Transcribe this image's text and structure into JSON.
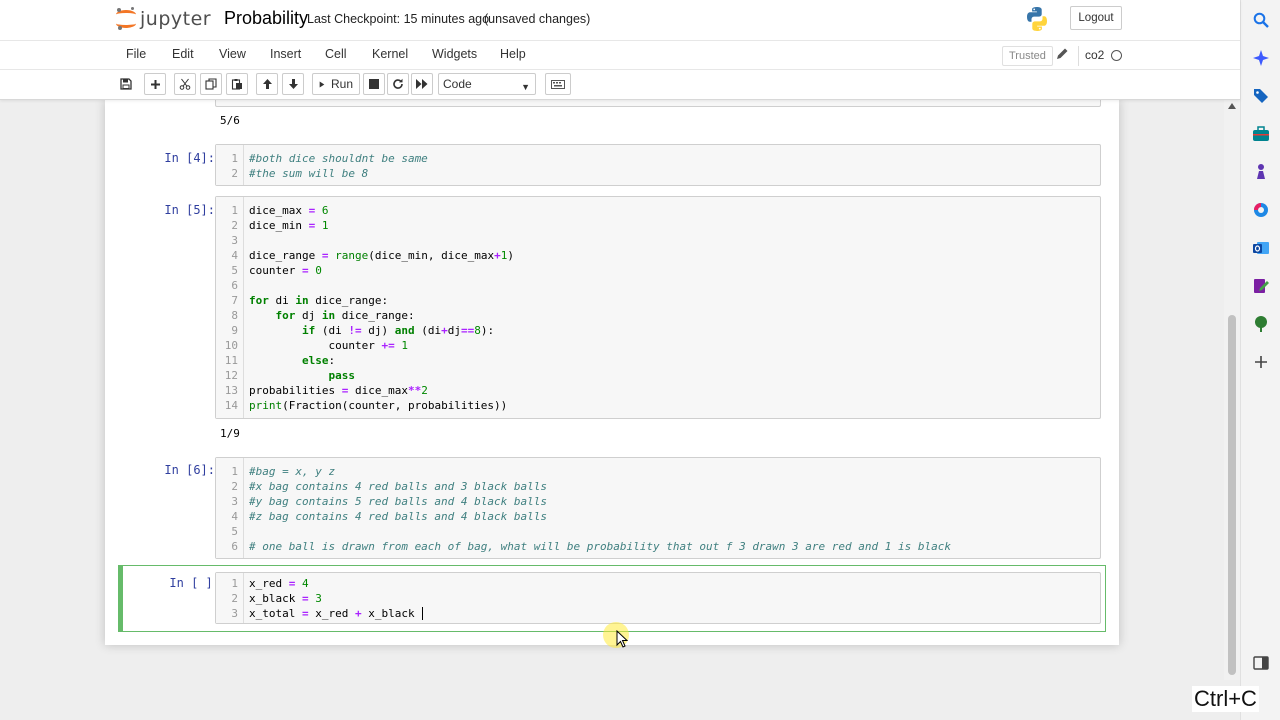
{
  "header": {
    "logo_text": "jupyter",
    "notebook_name": "Probability",
    "checkpoint": "Last Checkpoint: 15 minutes ago",
    "autosave": "(unsaved changes)",
    "logout_label": "Logout"
  },
  "menubar": {
    "items": [
      "File",
      "Edit",
      "View",
      "Insert",
      "Cell",
      "Kernel",
      "Widgets",
      "Help"
    ],
    "trusted_label": "Trusted",
    "kernel_name": "co2"
  },
  "toolbar": {
    "run_label": "Run",
    "cell_type": "Code"
  },
  "cells": {
    "prev_output": "5/6",
    "cell4": {
      "prompt": "In [4]:",
      "lines": [
        "#both dice shouldnt be same",
        "#the sum will be 8"
      ]
    },
    "cell5": {
      "prompt": "In [5]:",
      "output": "1/9"
    },
    "cell6": {
      "prompt": "In [6]:",
      "lines": [
        "#bag = x, y z",
        "#x bag contains 4 red balls and 3 black balls",
        "#y bag contains 5 red balls and 4 black balls",
        "#z bag contains 4 red balls and 4 black balls",
        "",
        "# one ball is drawn from each of bag, what will be probability that out f 3 drawn 3 are red and 1 is black"
      ]
    },
    "cell7": {
      "prompt": "In [ ]:"
    }
  },
  "overlay": {
    "shortcut_label": "Ctrl+C"
  },
  "colors": {
    "prompt": "#303f9f",
    "comment": "#408080",
    "keyword": "#008000",
    "operator": "#aa22ff",
    "active_cell_border": "#66bb6a",
    "jupyter_orange": "#f37626"
  },
  "icons": {
    "right_bar": [
      "search-icon",
      "sparkle-icon",
      "tag-icon",
      "toolbox-icon",
      "chess-icon",
      "copilot-icon",
      "outlook-icon",
      "edit-icon",
      "tree-icon",
      "plus-icon",
      "layout-icon"
    ]
  }
}
